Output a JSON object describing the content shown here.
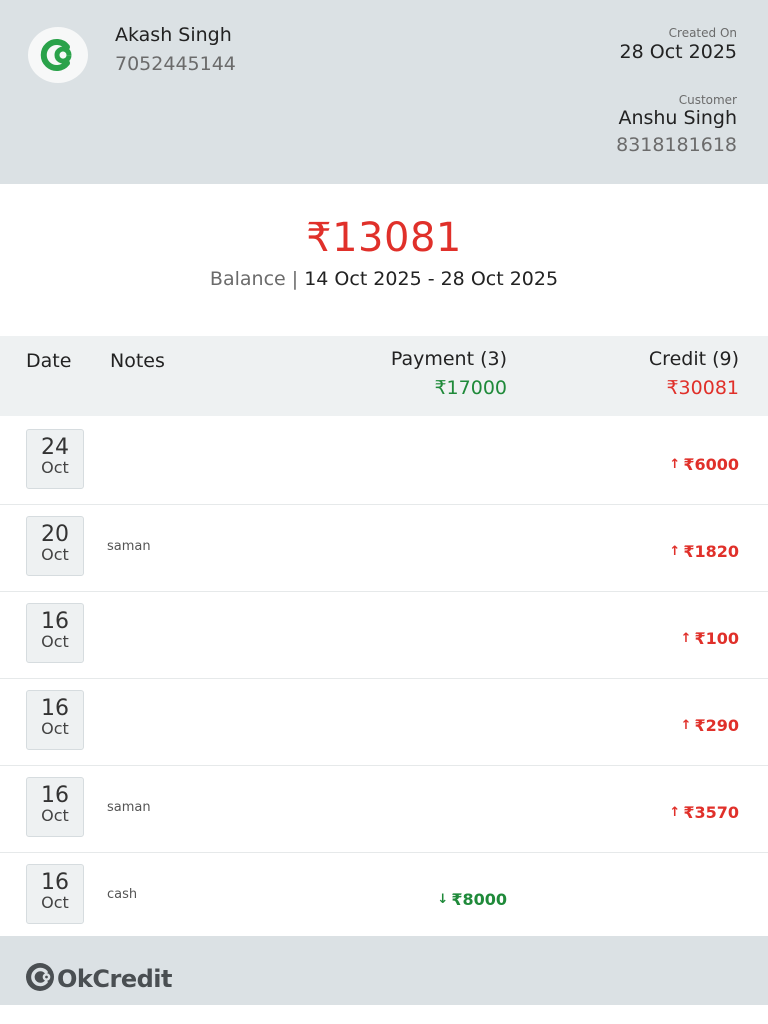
{
  "header": {
    "owner_name": "Akash Singh",
    "owner_phone": "7052445144",
    "created_label": "Created On",
    "created_date": "28 Oct 2025",
    "customer_label": "Customer",
    "customer_name": "Anshu Singh",
    "customer_phone": "8318181618",
    "logo_icon": "okcredit-logo-icon",
    "accent": "#2aa24a"
  },
  "balance": {
    "amount": "₹13081",
    "label": "Balance",
    "separator": "|",
    "range": "14 Oct 2025 - 28 Oct 2025",
    "color": "#e0302a"
  },
  "table": {
    "headers": {
      "date": "Date",
      "notes": "Notes",
      "payment": "Payment (3)",
      "credit": "Credit (9)"
    },
    "payment_total": "₹17000",
    "credit_total": "₹30081",
    "rows": [
      {
        "day": "24",
        "month": "Oct",
        "note": "",
        "type": "credit",
        "amount": "₹6000",
        "arrow": "↑"
      },
      {
        "day": "20",
        "month": "Oct",
        "note": "saman",
        "type": "credit",
        "amount": "₹1820",
        "arrow": "↑"
      },
      {
        "day": "16",
        "month": "Oct",
        "note": "",
        "type": "credit",
        "amount": "₹100",
        "arrow": "↑"
      },
      {
        "day": "16",
        "month": "Oct",
        "note": "",
        "type": "credit",
        "amount": "₹290",
        "arrow": "↑"
      },
      {
        "day": "16",
        "month": "Oct",
        "note": "saman",
        "type": "credit",
        "amount": "₹3570",
        "arrow": "↑"
      },
      {
        "day": "16",
        "month": "Oct",
        "note": "cash",
        "type": "payment",
        "amount": "₹8000",
        "arrow": "↓"
      }
    ]
  },
  "footer": {
    "brand": "OkCredit",
    "logo_icon": "okcredit-mark-icon"
  },
  "colors": {
    "credit": "#e0302a",
    "payment": "#1f8a3a",
    "header_bg": "#dbe1e4"
  }
}
